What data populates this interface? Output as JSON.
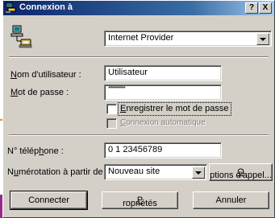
{
  "window": {
    "title": "Connexion à",
    "help_label": "?",
    "close_label": "X"
  },
  "connection": {
    "selected": "Internet Provider"
  },
  "username": {
    "label_mnemonic": "N",
    "label_rest": "om d'utilisateur :",
    "value": "Utilisateur"
  },
  "password": {
    "label_mnemonic": "M",
    "label_rest": "ot de passe :",
    "masked_value": "************"
  },
  "save_password": {
    "label_mnemonic": "E",
    "label_rest": "nregistrer le mot de passe",
    "checked": false
  },
  "auto_connect": {
    "label_mnemonic": "C",
    "label_rest": "onnexion automatique",
    "enabled": false
  },
  "phone": {
    "label_pre": "N° télép",
    "label_mnemonic": "h",
    "label_post": "one :",
    "value": "0 1 23456789"
  },
  "dialing": {
    "label_pre": "N",
    "label_mnemonic": "u",
    "label_post": "mérotation à partir de :",
    "selected": "Nouveau site",
    "options_mnemonic": "O",
    "options_rest": "ptions d'appel..."
  },
  "buttons": {
    "connect": "Connecter",
    "properties_mnemonic": "P",
    "properties_rest": "ropriétés",
    "cancel": "Annuler"
  },
  "colors": {
    "titlebar_start": "#0a246a",
    "titlebar_end": "#a6caf0",
    "dialog_face": "#d4d0c8"
  }
}
